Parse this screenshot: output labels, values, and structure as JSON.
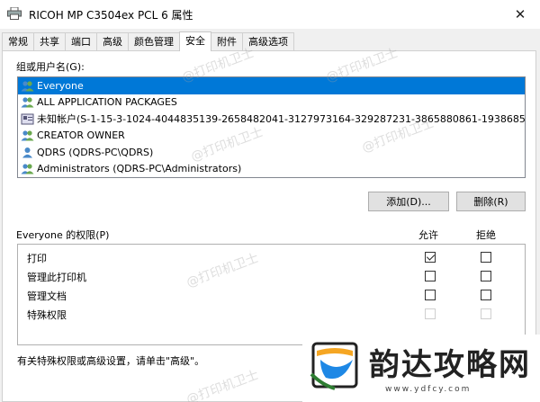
{
  "window": {
    "title": "RICOH MP C3504ex PCL 6 属性",
    "close_glyph": "✕"
  },
  "tabs": [
    {
      "label": "常规",
      "active": false
    },
    {
      "label": "共享",
      "active": false
    },
    {
      "label": "端口",
      "active": false
    },
    {
      "label": "高级",
      "active": false
    },
    {
      "label": "颜色管理",
      "active": false
    },
    {
      "label": "安全",
      "active": true
    },
    {
      "label": "附件",
      "active": false
    },
    {
      "label": "高级选项",
      "active": false
    }
  ],
  "security": {
    "users_label": "组或用户名(G):",
    "users": [
      {
        "name": "Everyone",
        "icon": "group-icon",
        "selected": true
      },
      {
        "name": "ALL APPLICATION PACKAGES",
        "icon": "group-icon",
        "selected": false
      },
      {
        "name": "未知帐户(S-1-15-3-1024-4044835139-2658482041-3127973164-329287231-3865880861-1938685643-46...",
        "icon": "unknown-account-icon",
        "selected": false
      },
      {
        "name": "CREATOR OWNER",
        "icon": "group-icon",
        "selected": false
      },
      {
        "name": "QDRS (QDRS-PC\\QDRS)",
        "icon": "user-icon",
        "selected": false
      },
      {
        "name": "Administrators (QDRS-PC\\Administrators)",
        "icon": "group-icon",
        "selected": false
      }
    ],
    "add_button": "添加(D)...",
    "remove_button": "删除(R)",
    "perm_label": "Everyone 的权限(P)",
    "allow_header": "允许",
    "deny_header": "拒绝",
    "permissions": [
      {
        "name": "打印",
        "allow": true,
        "deny": false,
        "disabled": false
      },
      {
        "name": "管理此打印机",
        "allow": false,
        "deny": false,
        "disabled": false
      },
      {
        "name": "管理文档",
        "allow": false,
        "deny": false,
        "disabled": false
      },
      {
        "name": "特殊权限",
        "allow": false,
        "deny": false,
        "disabled": true
      }
    ],
    "footnote": "有关特殊权限或高级设置，请单击\"高级\"。"
  },
  "watermark": "@打印机卫士",
  "brand": {
    "name": "韵达攻略网",
    "url": "www.ydfcy.com"
  },
  "colors": {
    "selection": "#0078d7",
    "button_bg": "#e1e1e1",
    "brand_orange": "#f5a623",
    "brand_blue": "#1e88e5"
  }
}
